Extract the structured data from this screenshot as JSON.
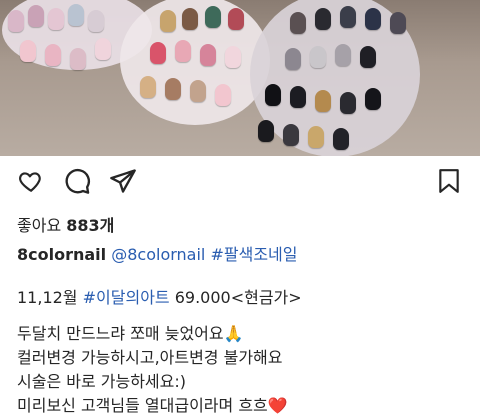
{
  "post": {
    "likes_label": "좋아요",
    "likes_count": "883개",
    "username": "8colornail",
    "mention": "@8colornail",
    "hashtag": "#팔색조네일",
    "line1_prefix": "11,12월 ",
    "line1_tag": "#이달의아트",
    "line1_suffix": " 69.000<현금가>",
    "line2": "두달치 만드느랴 쪼매 늦었어요🙏",
    "line3": "컬러변경 가능하시고,아트변경 불가해요",
    "line4": "시술은 바로 가능하세요:)",
    "line5": "미리보신 고객님들 열대급이라며 흐흐❤️"
  },
  "icons": {
    "like": "heart-outline-icon",
    "comment": "comment-bubble-icon",
    "share": "paper-plane-icon",
    "save": "bookmark-icon"
  }
}
